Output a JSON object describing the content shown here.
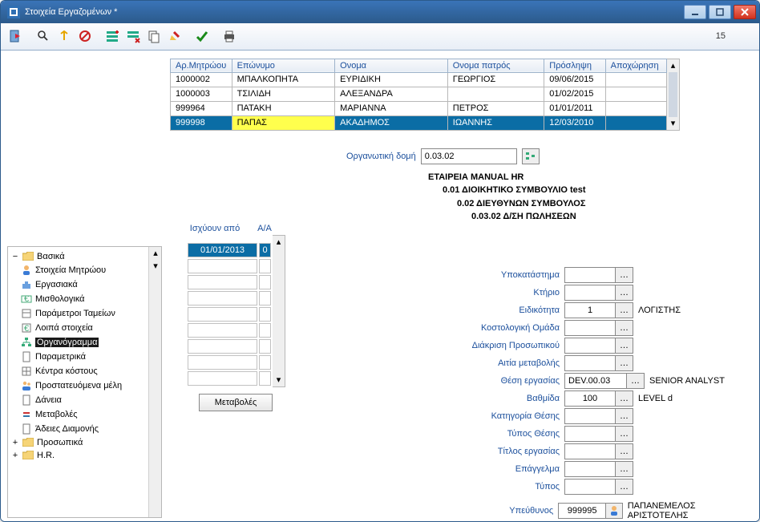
{
  "window": {
    "title": "Στοιχεία Εργαζομένων *",
    "counter": "15"
  },
  "grid": {
    "headers": [
      "Αρ.Μητρώου",
      "Επώνυμο",
      "Ονομα",
      "Ονομα πατρός",
      "Πρόσληψη",
      "Αποχώρηση"
    ],
    "rows": [
      {
        "id": "1000002",
        "surname": "ΜΠΑΛΚΟΠΗΤΑ",
        "name": "ΕΥΡΙΔΙΚΗ",
        "father": "ΓΕΩΡΓΙΟΣ",
        "hire": "09/06/2015",
        "leave": ""
      },
      {
        "id": "1000003",
        "surname": "ΤΣΙΛΙΔΗ",
        "name": "ΑΛΕΞΑΝΔΡΑ",
        "father": "",
        "hire": "01/02/2015",
        "leave": ""
      },
      {
        "id": "999964",
        "surname": "ΠΑΤΑΚΗ",
        "name": "ΜΑΡΙΑΝΝΑ",
        "father": "ΠΕΤΡΟΣ",
        "hire": "01/01/2011",
        "leave": ""
      },
      {
        "id": "999998",
        "surname": "ΠΑΠΑΣ",
        "name": "ΑΚΑΔΗΜΟΣ",
        "father": "ΙΩΑΝΝΗΣ",
        "hire": "12/03/2010",
        "leave": ""
      }
    ]
  },
  "org": {
    "label": "Οργανωτική δομή",
    "code": "0.03.02",
    "hierarchy": {
      "l0": "ΕΤΑΙΡΕΙΑ MANUAL HR",
      "l1": "0.01  ΔΙΟΙΚΗΤΙΚΟ ΣΥΜΒΟΥΛΙΟ test",
      "l2": "0.02  ΔΙΕΥΘΥΝΩΝ ΣΥΜΒΟΥΛΟΣ",
      "l3": "0.03.02  Δ/ΣΗ ΠΩΛΗΣΕΩΝ"
    }
  },
  "mini": {
    "header1": "Ισχύουν από",
    "header2": "Α/Α",
    "date": "01/01/2013",
    "aa": "0",
    "changes_btn": "Μεταβολές"
  },
  "fields": {
    "ypokatastima": {
      "label": "Υποκατάστημα",
      "value": "",
      "desc": ""
    },
    "ktirio": {
      "label": "Κτήριο",
      "value": "",
      "desc": ""
    },
    "eidikotita": {
      "label": "Ειδικότητα",
      "value": "1",
      "desc": "ΛΟΓΙΣΤΗΣ"
    },
    "kostologiki": {
      "label": "Κοστολογική Ομάδα",
      "value": "",
      "desc": ""
    },
    "diakrisi": {
      "label": "Διάκριση Προσωπικού",
      "value": "",
      "desc": ""
    },
    "aitia": {
      "label": "Αιτία μεταβολής",
      "value": "",
      "desc": ""
    },
    "thesi": {
      "label": "Θέση εργασίας",
      "value": "DEV.00.03",
      "desc": "SENIOR ANALYST"
    },
    "vathmida": {
      "label": "Βαθμίδα",
      "value": "100",
      "desc": "LEVEL d"
    },
    "katigoria": {
      "label": "Κατηγορία Θέσης",
      "value": "",
      "desc": ""
    },
    "typos_thesis": {
      "label": "Τύπος Θέσης",
      "value": "",
      "desc": ""
    },
    "titlos": {
      "label": "Τίτλος εργασίας",
      "value": "",
      "desc": ""
    },
    "epaggelma": {
      "label": "Επάγγελμα",
      "value": "",
      "desc": ""
    },
    "typos": {
      "label": "Τύπος",
      "value": "",
      "desc": ""
    },
    "ypeythynos": {
      "label": "Υπεύθυνος",
      "value": "999995",
      "desc": "ΠΑΠΑΝΕΜΕΛΟΣ ΑΡΙΣΤΟΤΕΛΗΣ"
    }
  },
  "tree": {
    "basika": "Βασικά",
    "items": [
      "Στοιχεία Μητρώου",
      "Εργασιακά",
      "Μισθολογικά",
      "Παράμετροι Ταμείων",
      "Λοιπά στοιχεία",
      "Οργανόγραμμα",
      "Παραμετρικά",
      "Κέντρα κόστους",
      "Προστατευόμενα μέλη",
      "Δάνεια",
      "Μεταβολές",
      "Άδειες Διαμονής"
    ],
    "prosopika": "Προσωπικά",
    "hr": "H.R."
  }
}
